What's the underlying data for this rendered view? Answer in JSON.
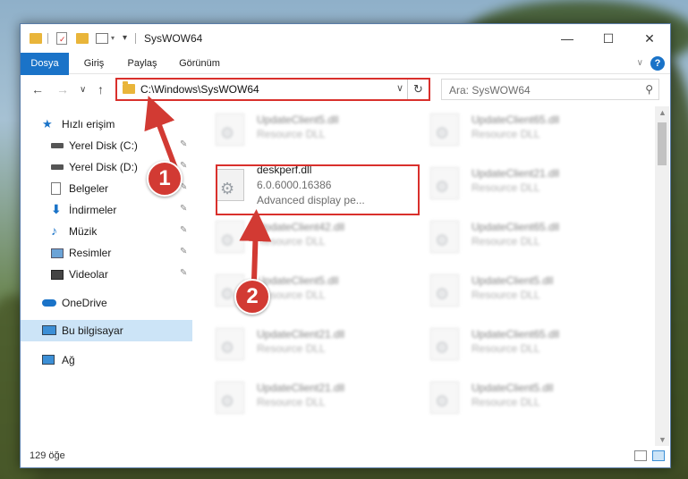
{
  "window": {
    "title": "SysWOW64",
    "minimize_glyph": "—",
    "maximize_glyph": "☐",
    "close_glyph": "✕"
  },
  "ribbon": {
    "tabs": [
      {
        "label": "Dosya"
      },
      {
        "label": "Giriş"
      },
      {
        "label": "Paylaş"
      },
      {
        "label": "Görünüm"
      }
    ],
    "collapse_glyph": "∨",
    "help_glyph": "?"
  },
  "nav": {
    "back_glyph": "←",
    "forward_glyph": "→",
    "recent_glyph": "∨",
    "up_glyph": "↑",
    "address": "C:\\Windows\\SysWOW64",
    "address_dropdown_glyph": "∨",
    "refresh_glyph": "↻",
    "search_placeholder": "Ara: SysWOW64",
    "search_glyph": "⚲"
  },
  "sidebar": {
    "items": [
      {
        "label": "Hızlı erişim",
        "icon": "star-icon"
      },
      {
        "label": "Yerel Disk (C:)",
        "icon": "drive-icon",
        "pinned": true
      },
      {
        "label": "Yerel Disk (D:)",
        "icon": "drive-icon",
        "pinned": true
      },
      {
        "label": "Belgeler",
        "icon": "documents-icon",
        "pinned": true
      },
      {
        "label": "İndirmeler",
        "icon": "download-icon",
        "pinned": true
      },
      {
        "label": "Müzik",
        "icon": "music-icon",
        "pinned": true
      },
      {
        "label": "Resimler",
        "icon": "pictures-icon",
        "pinned": true
      },
      {
        "label": "Videolar",
        "icon": "videos-icon",
        "pinned": true
      },
      {
        "label": "OneDrive",
        "icon": "cloud-icon"
      },
      {
        "label": "Bu bilgisayar",
        "icon": "computer-icon",
        "selected": true
      },
      {
        "label": "Ağ",
        "icon": "network-icon"
      }
    ],
    "pin_glyph": "📌"
  },
  "files": {
    "highlighted": {
      "name": "deskperf.dll",
      "version": "6.0.6000.16386",
      "description": "Advanced display pe..."
    },
    "left_column": [
      {
        "name": "UpdateClient5.dll",
        "type": "Resource DLL"
      },
      {
        "name": "UpdateClient42.dll",
        "type": "Resource DLL"
      },
      {
        "name": "UpdateClient5.dll",
        "type": "Resource DLL"
      },
      {
        "name": "UpdateClient21.dll",
        "type": "Resource DLL"
      },
      {
        "name": "UpdateClient21.dll",
        "type": "Resource DLL"
      }
    ],
    "right_column": [
      {
        "name": "UpdateClient65.dll",
        "type": "Resource DLL"
      },
      {
        "name": "UpdateClient21.dll",
        "type": "Resource DLL"
      },
      {
        "name": "UpdateClient65.dll",
        "type": "Resource DLL"
      },
      {
        "name": "UpdateClient5.dll",
        "type": "Resource DLL"
      },
      {
        "name": "UpdateClient65.dll",
        "type": "Resource DLL"
      },
      {
        "name": "UpdateClient5.dll",
        "type": "Resource DLL"
      }
    ]
  },
  "status": {
    "item_count": "129 öğe"
  },
  "annotations": {
    "step1": "1",
    "step2": "2",
    "color": "#d23a33"
  },
  "colors": {
    "accent": "#1a73c8",
    "highlight_border": "#d9302c",
    "selected_bg": "#cce4f7"
  }
}
